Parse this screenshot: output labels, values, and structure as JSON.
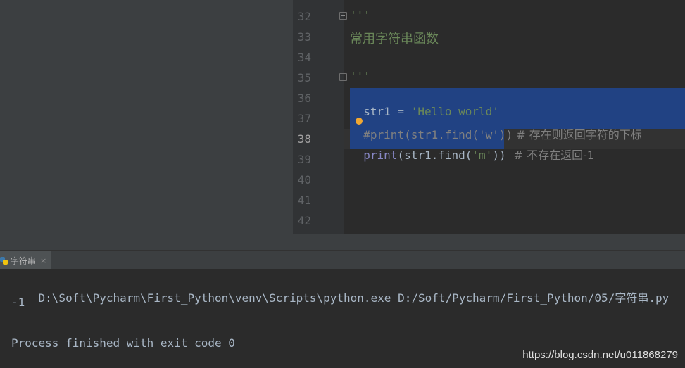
{
  "editor": {
    "line_numbers": [
      "32",
      "33",
      "34",
      "35",
      "36",
      "37",
      "38",
      "39",
      "40",
      "41",
      "42"
    ],
    "current_line": "38",
    "lines": {
      "l32": "'''",
      "l33": "常用字符串函数",
      "l35": "'''",
      "l36_var": "str1",
      "l36_op": " = ",
      "l36_str": "'Hello world'",
      "l37_hash": "#",
      "l37_code": "print(str1.find('w'))",
      "l37_comment": " # 存在则返回字符的下标",
      "l38_print": "print",
      "l38_open": "(str1.find(",
      "l38_str": "'m'",
      "l38_close": "))",
      "l38_comment": " # 不存在返回-1"
    }
  },
  "run": {
    "tab_label": "字符串",
    "tab_close": "×",
    "output": {
      "cmd_ascii": "D:\\Soft\\Pycharm\\First_Python\\venv\\Scripts\\python.exe D:/Soft/Pycharm/First_Python/05/",
      "cmd_cjk": "字符串",
      "cmd_ext": ".py",
      "result": "-1",
      "finish": "Process finished with exit code 0"
    }
  },
  "watermark": "https://blog.csdn.net/u011868279"
}
